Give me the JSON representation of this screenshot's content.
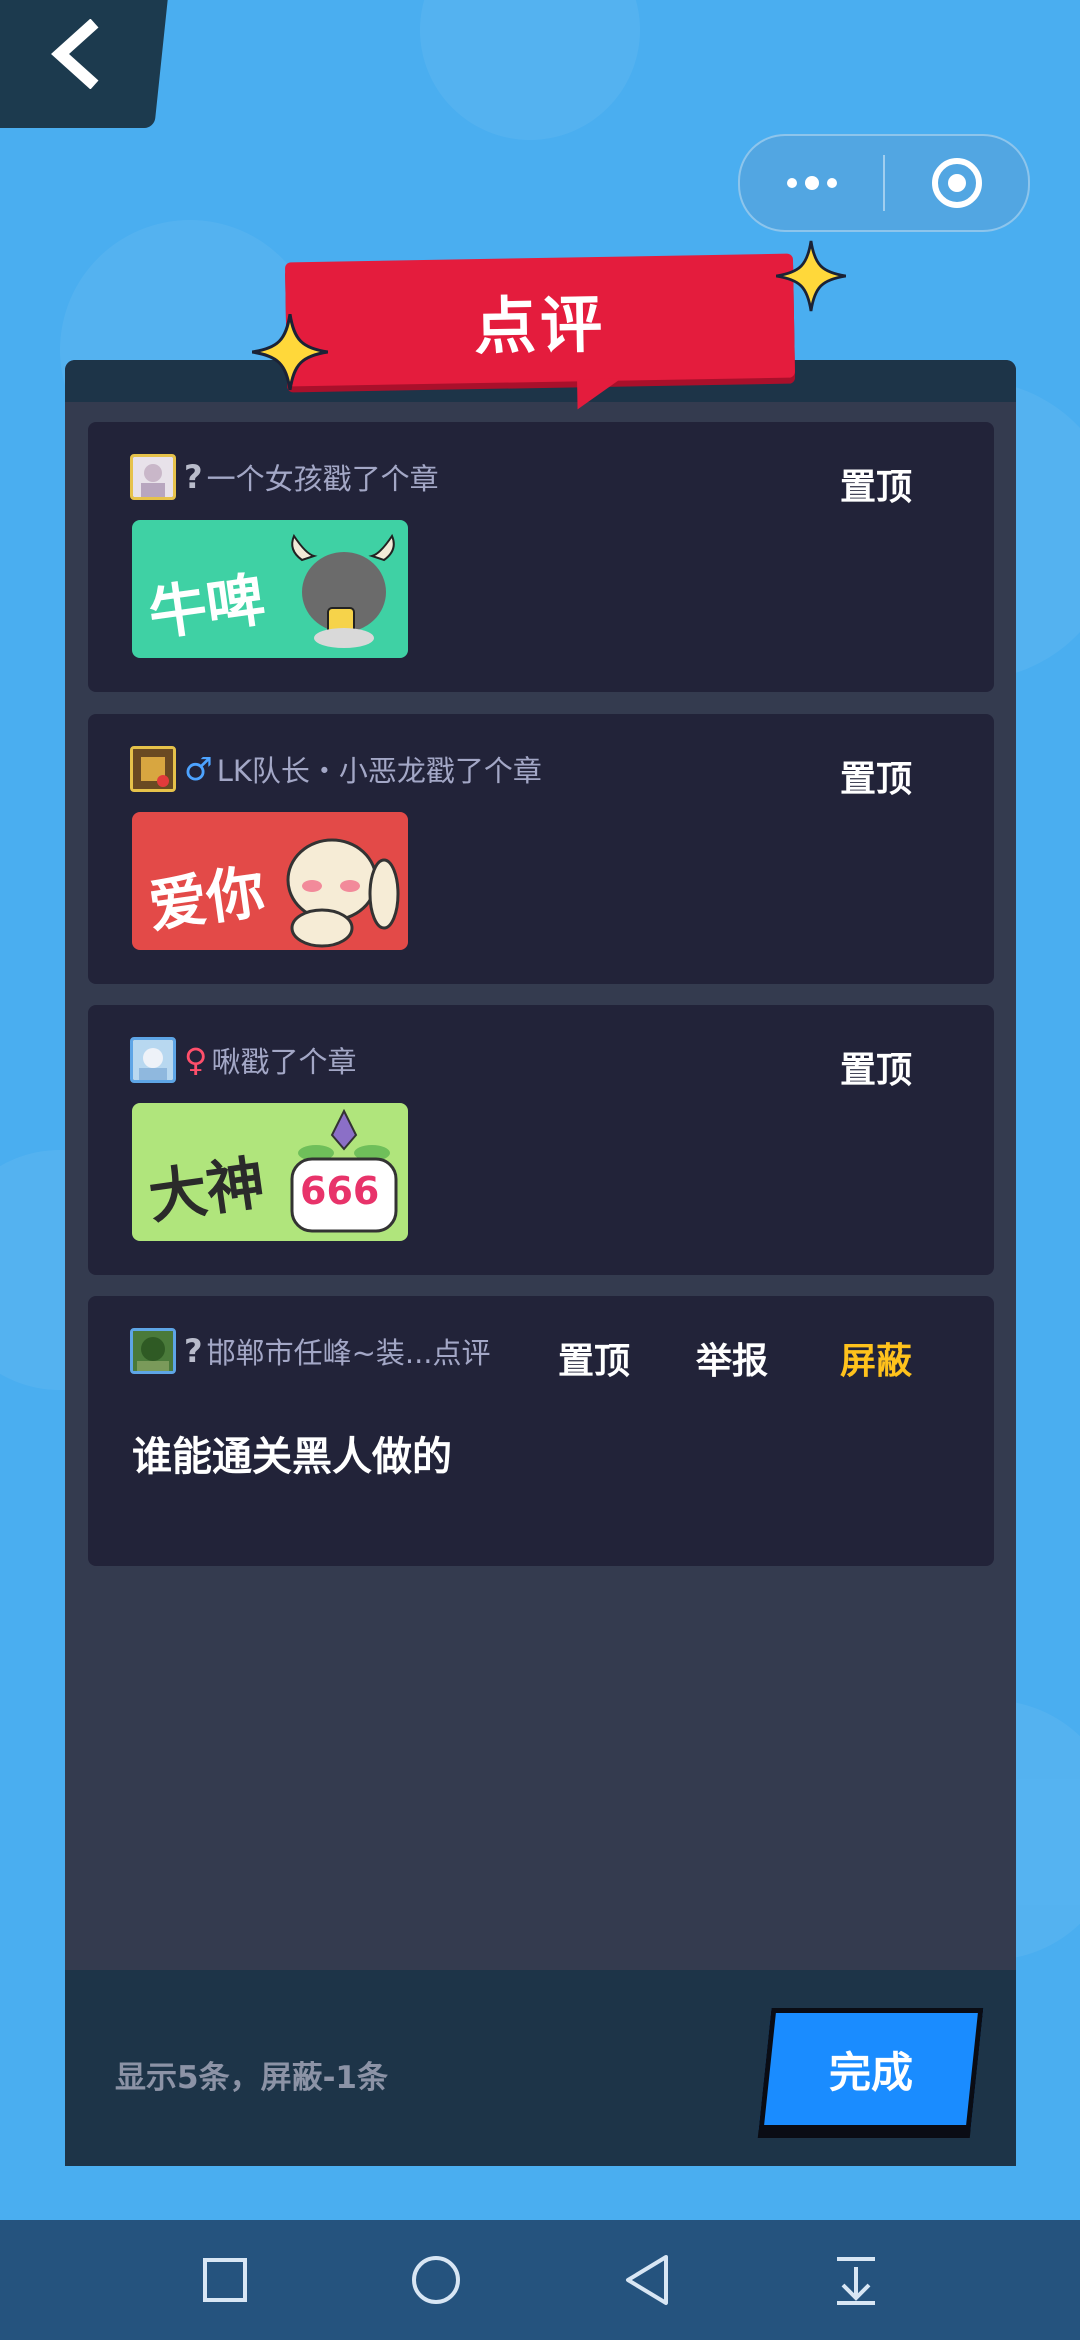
{
  "title": "点评",
  "cards": [
    {
      "gender": "?",
      "user": "一个女孩戳了个章",
      "actions": [
        "置顶"
      ],
      "sticker_text": "牛啤",
      "sticker_color": "#3fd1a4"
    },
    {
      "gender": "♂",
      "user": "LK队长・小恶龙戳了个章",
      "actions": [
        "置顶"
      ],
      "sticker_text": "爱你",
      "sticker_color": "#e34a48"
    },
    {
      "gender": "♀",
      "user": "啾戳了个章",
      "actions": [
        "置顶"
      ],
      "sticker_text": "大神",
      "sticker_badge": "666",
      "sticker_color": "#b0e57c"
    },
    {
      "gender": "?",
      "user": "邯郸市任峰~装...点评",
      "actions": [
        "置顶",
        "举报",
        "屏蔽"
      ],
      "comment": "谁能通关黑人做的"
    }
  ],
  "footer": {
    "info": "显示5条，屏蔽-1条",
    "done_label": "完成"
  },
  "colors": {
    "accent_orange": "#ffc21c",
    "banner_red": "#e41c3d",
    "button_blue": "#1a8cff"
  }
}
